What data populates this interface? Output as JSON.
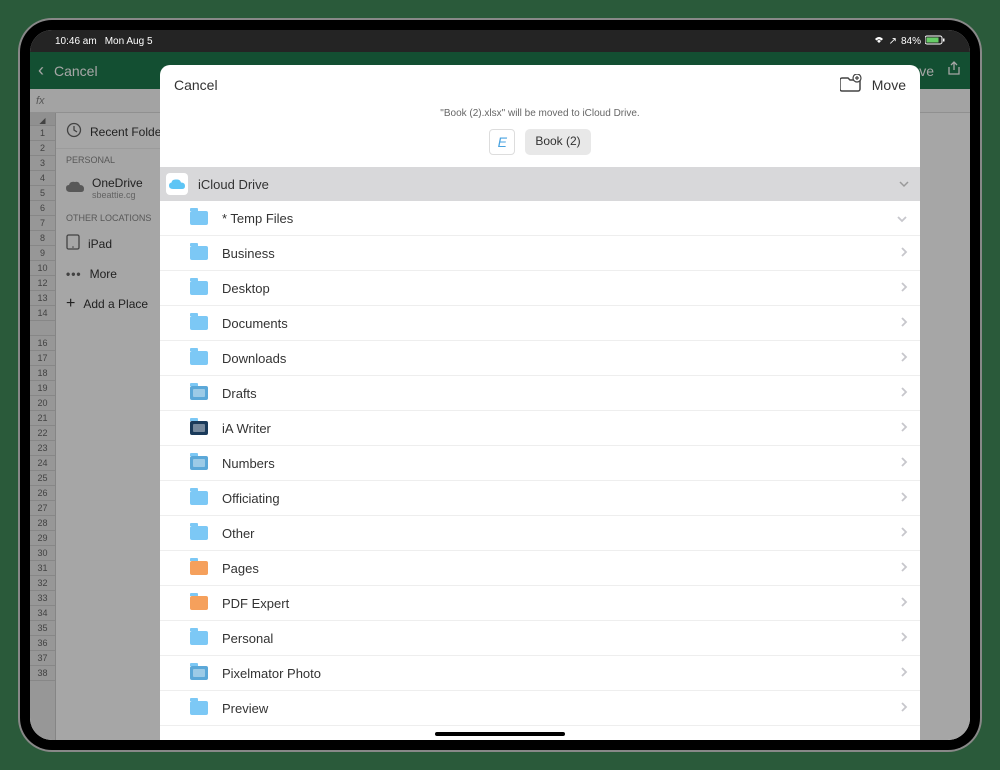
{
  "status_bar": {
    "time": "10:46 am",
    "date": "Mon Aug 5",
    "battery": "84%",
    "location_indicator": "↗"
  },
  "excel_bg": {
    "cancel": "Cancel",
    "save": "Save",
    "fx": "fx",
    "sidebar": {
      "recent": "Recent Folders",
      "personal_hdr": "PERSONAL",
      "onedrive": "OneDrive",
      "onedrive_sub": "sbeattie.cg",
      "other_hdr": "OTHER LOCATIONS",
      "ipad": "iPad",
      "more": "More",
      "add": "Add a Place"
    }
  },
  "modal": {
    "cancel": "Cancel",
    "move": "Move",
    "subtitle": "\"Book (2).xlsx\" will be moved to iCloud Drive.",
    "file_initial": "E",
    "file_name": "Book (2)",
    "location": "iCloud Drive",
    "folders": [
      {
        "label": "* Temp Files",
        "type": "folder",
        "expandable": true
      },
      {
        "label": "Business",
        "type": "folder"
      },
      {
        "label": "Desktop",
        "type": "folder"
      },
      {
        "label": "Documents",
        "type": "folder"
      },
      {
        "label": "Downloads",
        "type": "folder"
      },
      {
        "label": "Drafts",
        "type": "app"
      },
      {
        "label": "iA Writer",
        "type": "app-dark"
      },
      {
        "label": "Numbers",
        "type": "app"
      },
      {
        "label": "Officiating",
        "type": "folder"
      },
      {
        "label": "Other",
        "type": "folder"
      },
      {
        "label": "Pages",
        "type": "orange"
      },
      {
        "label": "PDF Expert",
        "type": "orange"
      },
      {
        "label": "Personal",
        "type": "folder"
      },
      {
        "label": "Pixelmator Photo",
        "type": "app"
      },
      {
        "label": "Preview",
        "type": "folder"
      }
    ]
  }
}
